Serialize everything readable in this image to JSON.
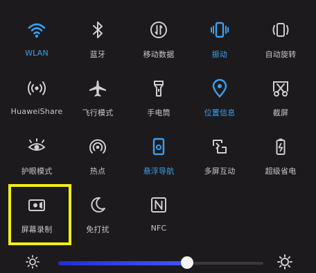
{
  "tiles": [
    {
      "label": "WLAN",
      "active": true,
      "icon": "wifi-icon"
    },
    {
      "label": "蓝牙",
      "active": false,
      "icon": "bluetooth-icon"
    },
    {
      "label": "移动数据",
      "active": false,
      "icon": "mobile-data-icon"
    },
    {
      "label": "振动",
      "active": true,
      "icon": "vibrate-icon"
    },
    {
      "label": "自动旋转",
      "active": false,
      "icon": "auto-rotate-icon"
    },
    {
      "label": "HuaweiShare",
      "active": false,
      "icon": "huawei-share-icon"
    },
    {
      "label": "飞行模式",
      "active": false,
      "icon": "airplane-icon"
    },
    {
      "label": "手电筒",
      "active": false,
      "icon": "flashlight-icon"
    },
    {
      "label": "位置信息",
      "active": true,
      "icon": "location-icon"
    },
    {
      "label": "截屏",
      "active": false,
      "icon": "screenshot-icon"
    },
    {
      "label": "护眼模式",
      "active": false,
      "icon": "eye-comfort-icon"
    },
    {
      "label": "热点",
      "active": false,
      "icon": "hotspot-icon"
    },
    {
      "label": "悬浮导航",
      "active": true,
      "icon": "floating-nav-icon"
    },
    {
      "label": "多屏互动",
      "active": false,
      "icon": "multi-screen-icon"
    },
    {
      "label": "超级省电",
      "active": false,
      "icon": "battery-saver-icon"
    },
    {
      "label": "屏幕录制",
      "active": false,
      "icon": "screen-record-icon"
    },
    {
      "label": "免打扰",
      "active": false,
      "icon": "do-not-disturb-icon"
    },
    {
      "label": "NFC",
      "active": false,
      "icon": "nfc-icon"
    }
  ],
  "brightness": {
    "level": 0.63
  },
  "colors": {
    "active": "#3aa0f0",
    "inactive": "#c9c7c9",
    "highlight": "#f2ee17",
    "slider": "#2f45f0"
  }
}
